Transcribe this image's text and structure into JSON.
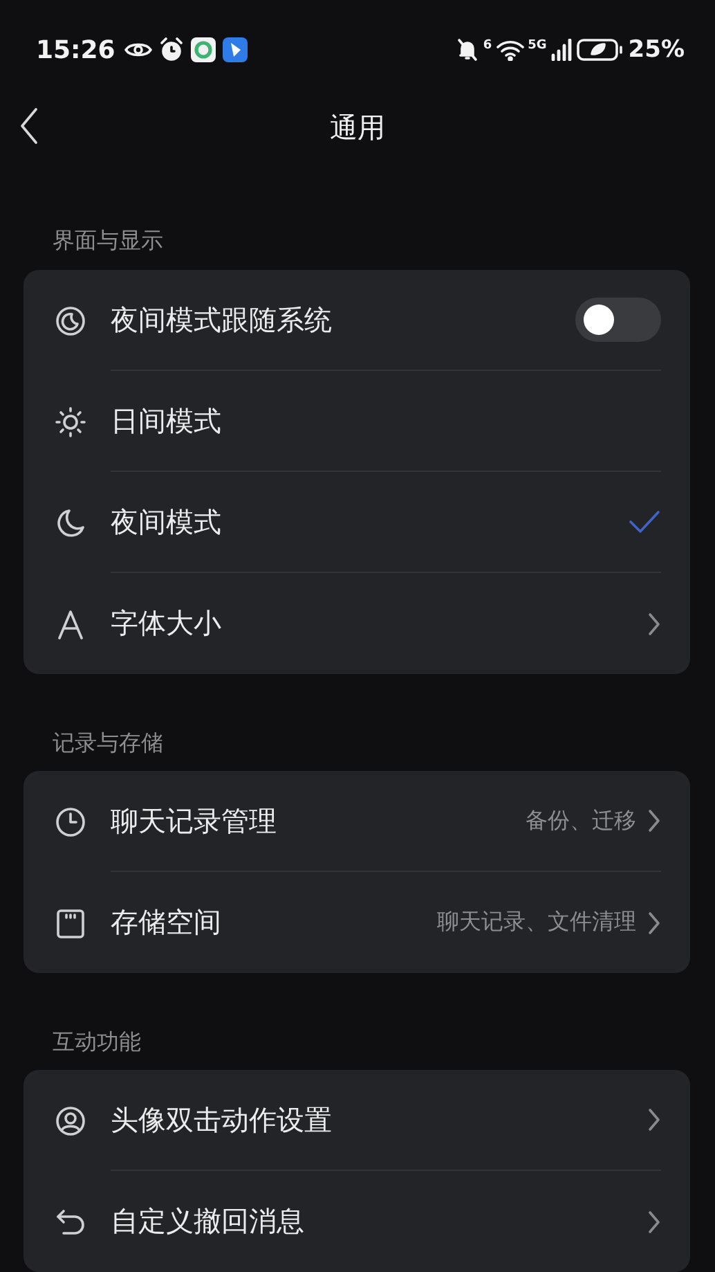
{
  "status_bar": {
    "time": "15:26",
    "wifi_label": "6",
    "network": "5G",
    "battery": "25%"
  },
  "header": {
    "title": "通用"
  },
  "sections": [
    {
      "title": "界面与显示",
      "rows": [
        {
          "kind": "toggle",
          "label": "夜间模式跟随系统",
          "on": false
        },
        {
          "kind": "option",
          "label": "日间模式",
          "selected": false
        },
        {
          "kind": "option",
          "label": "夜间模式",
          "selected": true
        },
        {
          "kind": "link",
          "label": "字体大小"
        }
      ]
    },
    {
      "title": "记录与存储",
      "rows": [
        {
          "kind": "link",
          "label": "聊天记录管理",
          "value": "备份、迁移"
        },
        {
          "kind": "link",
          "label": "存储空间",
          "value": "聊天记录、文件清理"
        }
      ]
    },
    {
      "title": "互动功能",
      "rows": [
        {
          "kind": "link",
          "label": "头像双击动作设置"
        },
        {
          "kind": "link",
          "label": "自定义撤回消息"
        }
      ]
    }
  ]
}
